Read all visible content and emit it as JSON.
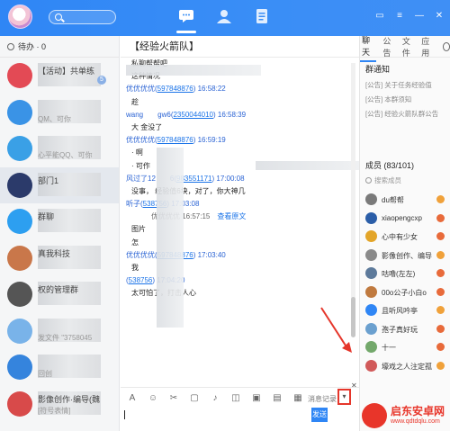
{
  "left": {
    "todo_label": "待办 · 0",
    "conversations": [
      {
        "name": "【活动】共单练",
        "preview": "",
        "badge": "5",
        "color": "#e34a55"
      },
      {
        "name": "",
        "preview": "QM、可你",
        "badge": "",
        "color": "#3a93e6"
      },
      {
        "name": "",
        "preview": "心平能QQ、可你",
        "badge": "",
        "color": "#3aa0e6"
      },
      {
        "name": "部门1",
        "preview": "",
        "badge": "",
        "color": "#2b3a6a"
      },
      {
        "name": "群聊",
        "preview": "",
        "badge": "",
        "color": "#2d9ff0"
      },
      {
        "name": "真我科技",
        "preview": "",
        "badge": "",
        "color": "#c9774a"
      },
      {
        "name": "权的管理群",
        "preview": "",
        "badge": "",
        "color": "#555"
      },
      {
        "name": "",
        "preview": "发文件 \"3758045",
        "badge": "",
        "color": "#79b3e9"
      },
      {
        "name": "",
        "preview": "回创",
        "badge": "",
        "color": "#3584dd"
      },
      {
        "name": "影像创作·编导(魏",
        "preview": "[符号表情]",
        "badge": "",
        "color": "#d84a4a"
      }
    ]
  },
  "chat": {
    "title": "【经验火箭队】",
    "messages": [
      {
        "kind": "text",
        "text": "私聊帮帮吧"
      },
      {
        "kind": "text",
        "text": "这种情况"
      },
      {
        "kind": "sender",
        "name": "优优优优",
        "num": "597848876",
        "time": "16:58:22"
      },
      {
        "kind": "text",
        "text": "趁"
      },
      {
        "kind": "sender",
        "name": "wang",
        "num": "2350044010",
        "time": "16:58:39",
        "mid": "gw6"
      },
      {
        "kind": "text",
        "text": "大    金没了"
      },
      {
        "kind": "sender",
        "name": "优优优优",
        "num": "597848876",
        "time": "16:59:19"
      },
      {
        "kind": "text",
        "text": "· 啊"
      },
      {
        "kind": "text",
        "text": "· 可作"
      },
      {
        "kind": "sender",
        "name": "风过了12",
        "num": "983551171",
        "time": "17:00:08",
        "mid": "6"
      },
      {
        "kind": "text",
        "text": "没事，     经验值6块，对了，你大神几"
      },
      {
        "kind": "sender",
        "name": "听子",
        "num": "538756",
        "time": "17:03:08"
      },
      {
        "kind": "recall",
        "text": "优优优优  16:57:15",
        "link": "查看原文"
      },
      {
        "kind": "text",
        "text": "图片"
      },
      {
        "kind": "text",
        "text": "怎"
      },
      {
        "kind": "sender",
        "name": "优优优优",
        "num": "597848876",
        "time": "17:03:40"
      },
      {
        "kind": "text",
        "text": "我"
      },
      {
        "kind": "sender",
        "name": "",
        "num": "538756",
        "time": "17:04:20"
      },
      {
        "kind": "text",
        "text": "太可怕了，打击人心"
      }
    ],
    "history_label": "消息记录",
    "send_label": "发送"
  },
  "right": {
    "tabs": [
      "聊天",
      "公告",
      "文件",
      "应用"
    ],
    "notice_title": "群通知",
    "notices": [
      "[公告] 关于任务经验值",
      "[公告] 本群须知",
      "[公告] 经验火箭队群公告"
    ],
    "members_title": "成员 (83/101)",
    "search_placeholder": "搜索成员",
    "members": [
      {
        "name": "du帮帮",
        "color": "#7a7a7a"
      },
      {
        "name": "xiaopengcxp",
        "color": "#2b5ea8"
      },
      {
        "name": "心中有少女",
        "color": "#e3a529"
      },
      {
        "name": "影像创作、编导",
        "color": "#8a8a8a"
      },
      {
        "name": "咕噜(左左)",
        "color": "#5d7a9b"
      },
      {
        "name": "00o公子小白o",
        "color": "#c07a3f"
      },
      {
        "name": "且听风吟亭",
        "color": "#2f86f5"
      },
      {
        "name": "孢子真好玩",
        "color": "#6ba0cf"
      },
      {
        "name": "十一",
        "color": "#73a86b"
      },
      {
        "name": "壕戏之人注定孤",
        "color": "#d15a5a"
      }
    ]
  },
  "watermark": {
    "title": "启东安卓网",
    "url": "www.qdtdqlu.com"
  }
}
